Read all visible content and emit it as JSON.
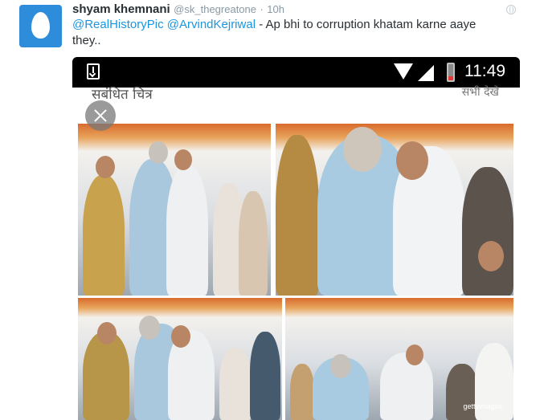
{
  "tweet": {
    "author_name": "shyam khemnani",
    "handle": "@sk_thegreatone",
    "separator": "·",
    "time": "10h",
    "mention_1": "@RealHistoryPic",
    "mention_2": "@ArvindKejriwal",
    "text_rest": " - Ap bhi to corruption khatam karne aaye they.."
  },
  "screenshot": {
    "clock": "11:49",
    "gallery_title": "सबंधित चित्र",
    "see_all": "सभी देखे",
    "photo_watermark": "gettyimages"
  },
  "colors": {
    "link": "#1b95e0",
    "avatar_bg": "#2e8ddb",
    "status_bar": "#000000"
  }
}
